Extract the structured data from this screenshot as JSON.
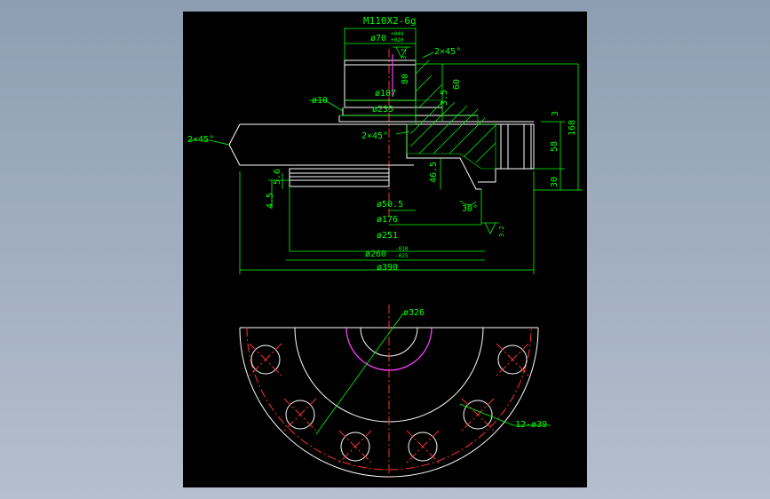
{
  "drawing": {
    "colors": {
      "background": "#000000",
      "outline": "#ffffff",
      "dimension": "#00ff00",
      "centerline": "#ff3030",
      "highlight": "#ff33ff"
    },
    "labels": {
      "thread": "M110X2-6g",
      "d70": "ø70",
      "d70_tol_up": "+040",
      "d70_tol_dn": "+020",
      "chamfer_top": "2×45°",
      "d107": "ø107",
      "d10": "ø10",
      "d235": "ø235",
      "chamfer_mid": "2×45°",
      "chamfer_left": "2×45°",
      "h80": "80",
      "h60": "60",
      "h35": "3.5",
      "h3": "3",
      "h168": "168",
      "h58": "58",
      "h30": "30",
      "h465": "46.5",
      "h56": "5.6",
      "h45": "4.5",
      "d505": "ø50.5",
      "ang30": "30°",
      "d176": "ø176",
      "d251": "ø251",
      "d260": "ø260",
      "d260_tol_up": "-010",
      "d260_tol_dn": "-025",
      "d390": "ø390",
      "rough_top": "3.2",
      "rough_bot": "3.2",
      "d326": "ø326",
      "holes": "12-ø39"
    }
  }
}
